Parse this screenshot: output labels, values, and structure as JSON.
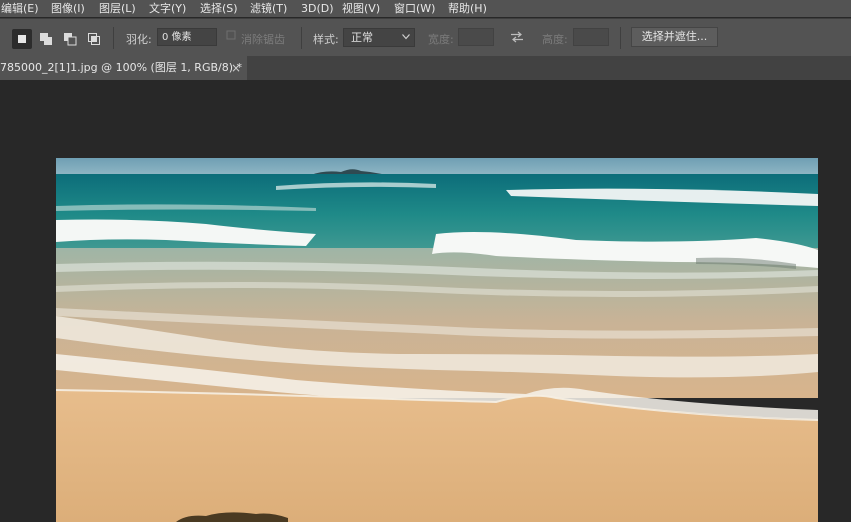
{
  "menubar": {
    "items": [
      "编辑(E)",
      "图像(I)",
      "图层(L)",
      "文字(Y)",
      "选择(S)",
      "滤镜(T)",
      "3D(D)",
      "视图(V)",
      "窗口(W)",
      "帮助(H)"
    ]
  },
  "options": {
    "feather_label": "羽化:",
    "feather_value": "0 像素",
    "antialias_label": "消除锯齿",
    "style_label": "样式:",
    "style_value": "正常",
    "width_label": "宽度:",
    "height_label": "高度:",
    "select_mask_label": "选择并遮住..."
  },
  "document_tab": {
    "title": "785000_2[1]1.jpg @ 100% (图层 1, RGB/8) *",
    "close": "×"
  },
  "colors": {
    "panel": "#535353",
    "workspace": "#282828",
    "sea": "#1f8a88",
    "sand": "#e0b582"
  }
}
